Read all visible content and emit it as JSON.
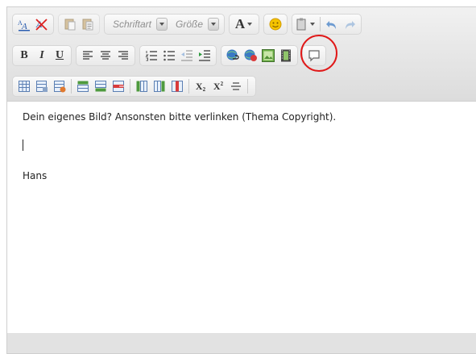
{
  "toolbar": {
    "font_family_label": "Schriftart",
    "font_size_label": "Größe",
    "text_color_glyph": "A",
    "bold_glyph": "B",
    "italic_glyph": "I",
    "underline_glyph": "U",
    "subscript_glyph": "X",
    "subscript_sub": "2",
    "superscript_glyph": "X",
    "superscript_sup": "2"
  },
  "content": {
    "line1": "Dein eigenes Bild? Ansonsten bitte verlinken (Thema Copyright).",
    "line3": "Hans"
  },
  "colors": {
    "highlight": "#e01818",
    "smiley": "#f5c400",
    "link": "#2f8a36",
    "unlink": "#d93b3b"
  }
}
